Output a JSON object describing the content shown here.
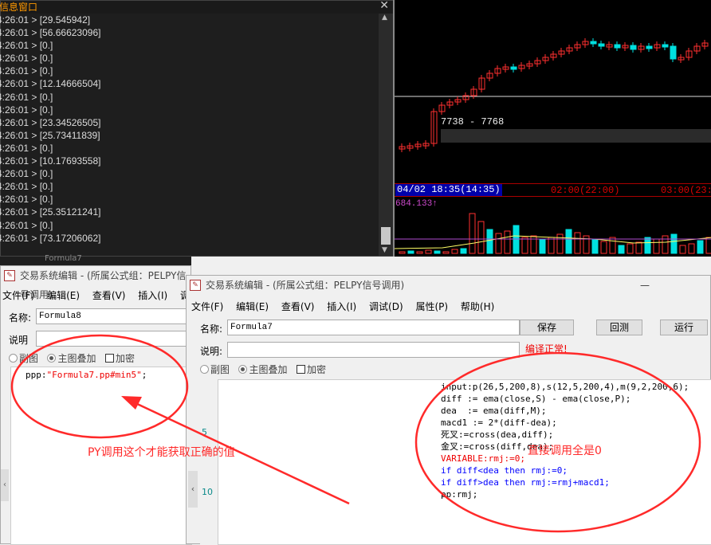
{
  "message_window": {
    "title": "信息窗口",
    "close_label": "✕",
    "lines": [
      "4:26:01 > [29.545942]",
      "4:26:01 > [56.66623096]",
      "4:26:01 > [0.]",
      "4:26:01 > [0.]",
      "4:26:01 > [0.]",
      "4:26:01 > [12.14666504]",
      "4:26:01 > [0.]",
      "4:26:01 > [0.]",
      "4:26:01 > [23.34526505]",
      "4:26:01 > [25.73411839]",
      "4:26:01 > [0.]",
      "4:26:01 > [10.17693558]",
      "4:26:01 > [0.]",
      "4:26:01 > [0.]",
      "4:26:01 > [0.]",
      "4:26:01 > [25.35121241]",
      "4:26:01 > [0.]",
      "4:26:01 > [73.17206062]"
    ]
  },
  "chart": {
    "price_label": "7738 - 7768",
    "time_selected": "04/02 18:35(14:35)",
    "time_labels": [
      "02:00(22:00)",
      "03:00(23:"
    ],
    "volume_label": "684.133↑",
    "up_color": "#ff3030",
    "down_color": "#00e0e0"
  },
  "back_dialog": {
    "tab_title": "Formula7",
    "title": "交易系统编辑 - (所属公式组：PELPY信号调用)",
    "menu": [
      "文件(F)",
      "编辑(E)",
      "查看(V)",
      "插入(I)",
      "调试"
    ],
    "name_label": "名称:",
    "name_value": "Formula8",
    "desc_label": "说明",
    "radio_sub": "副图",
    "radio_main": "主图叠加",
    "check_encrypt": "加密",
    "code_prefix": "ppp:",
    "code_string": "\"Formula7.pp#min5\"",
    "code_suffix": ";"
  },
  "front_dialog": {
    "title": "交易系统编辑 - (所属公式组：PELPY信号调用)",
    "menu": [
      "文件(F)",
      "编辑(E)",
      "查看(V)",
      "插入(I)",
      "调试(D)",
      "属性(P)",
      "帮助(H)"
    ],
    "name_label": "名称:",
    "name_value": "Formula7",
    "desc_label": "说明:",
    "save_button": "保存",
    "cancel_button": "回测",
    "run_button": "运行",
    "status": "编译正常!",
    "radio_sub": "副图",
    "radio_main": "主图叠加",
    "check_encrypt": "加密",
    "line_numbers": [
      "5",
      "10"
    ],
    "code_lines": [
      "input:p(26,5,200,8),s(12,5,200,4),m(9,2,200,6);",
      "diff := ema(close,S) - ema(close,P);",
      "dea  := ema(diff,M);",
      "macd1 := 2*(diff-dea);",
      "死叉:=cross(dea,diff);",
      "金叉:=cross(diff,dea);",
      "VARIABLE:rmj:=0;",
      "if diff<dea then rmj:=0;",
      "if diff>dea then rmj:=rmj+macd1;",
      "pp:rmj;"
    ]
  },
  "annotations": {
    "left_note": "PY调用这个才能获取正确的值",
    "right_note": "直接调用全是0",
    "color": "#ff2a2a"
  }
}
